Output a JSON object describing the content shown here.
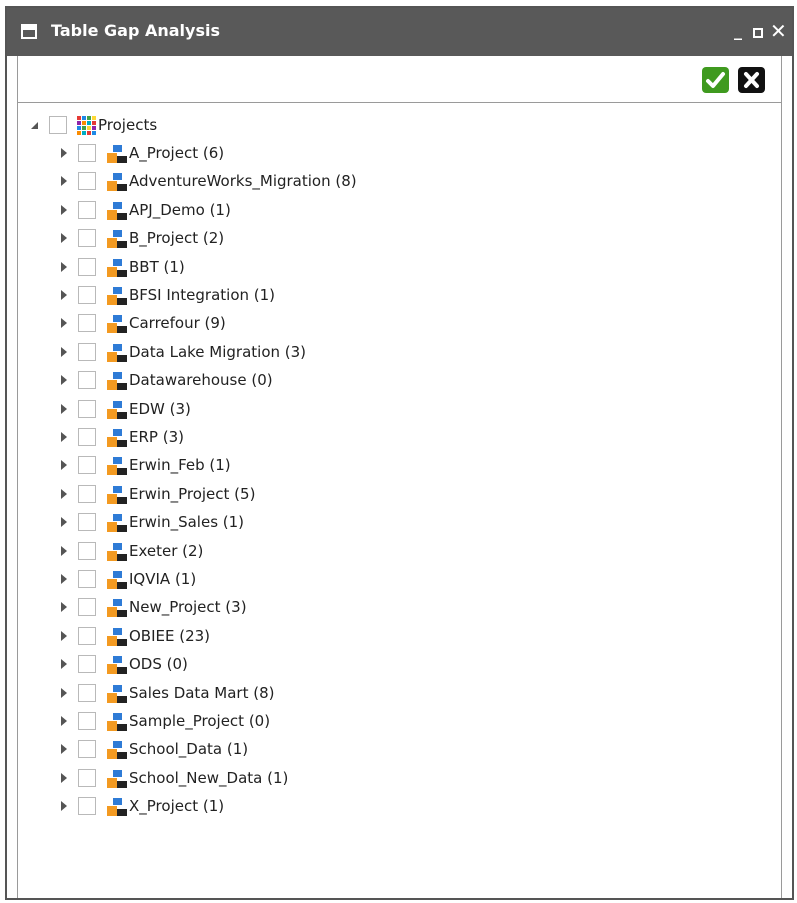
{
  "window": {
    "title": "Table Gap Analysis"
  },
  "toolbar": {
    "ok_icon": "checkmark-icon",
    "cancel_icon": "x-icon"
  },
  "tree": {
    "root": {
      "label": "Projects"
    },
    "projects": [
      "A_Project (6)",
      "AdventureWorks_Migration (8)",
      "APJ_Demo (1)",
      "B_Project (2)",
      "BBT (1)",
      "BFSI Integration (1)",
      "Carrefour (9)",
      "Data Lake Migration (3)",
      "Datawarehouse (0)",
      "EDW (3)",
      "ERP (3)",
      "Erwin_Feb (1)",
      "Erwin_Project (5)",
      "Erwin_Sales (1)",
      "Exeter (2)",
      "IQVIA (1)",
      "New_Project (3)",
      "OBIEE (23)",
      "ODS (0)",
      "Sales Data Mart (8)",
      "Sample_Project (0)",
      "School_Data (1)",
      "School_New_Data (1)",
      "X_Project (1)"
    ]
  },
  "colors": {
    "titlebar": "#595959",
    "accept": "#3f9a1f",
    "project_icon_orange": "#f39a21",
    "project_icon_blue": "#2e7bd6"
  }
}
